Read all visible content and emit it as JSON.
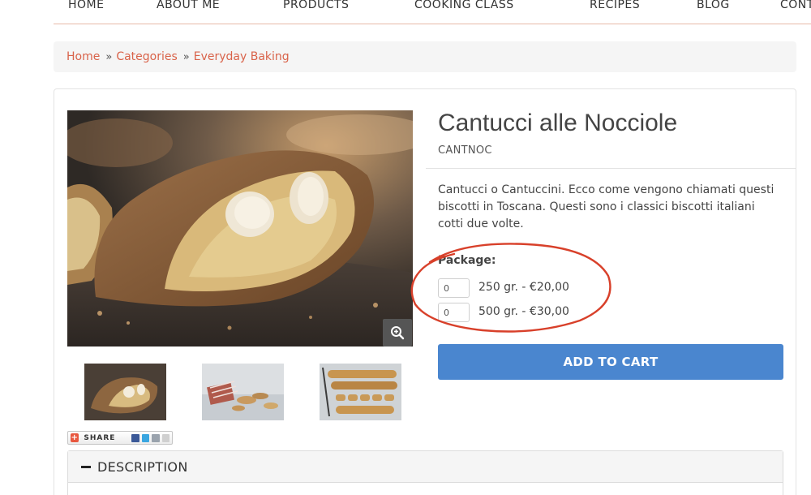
{
  "nav": {
    "items": [
      "HOME",
      "ABOUT ME",
      "PRODUCTS",
      "COOKING CLASS",
      "RECIPES",
      "BLOG",
      "CONT"
    ]
  },
  "breadcrumb": {
    "items": [
      "Home",
      "Categories",
      "Everyday Baking"
    ],
    "separator": "»"
  },
  "product": {
    "title": "Cantucci alle Nocciole",
    "sku": "CANTNOC",
    "description": "Cantucci o Cantuccini. Ecco come vengono chiamati questi biscotti in Toscana. Questi sono i classici biscotti italiani cotti due volte.",
    "package_label": "Package:",
    "options": [
      {
        "qty": "0",
        "label": "250 gr. - €20,00"
      },
      {
        "qty": "0",
        "label": "500 gr. - €30,00"
      }
    ],
    "add_to_cart": "ADD TO CART"
  },
  "share": {
    "label": "SHARE"
  },
  "tabs": {
    "description": "DESCRIPTION"
  },
  "colors": {
    "accent_link": "#d9634a",
    "cart_button": "#4a86cf",
    "annotation_circle": "#d8402a"
  },
  "icons": [
    "zoom-in-icon",
    "share-plus-icon",
    "facebook-icon",
    "twitter-icon",
    "email-icon",
    "more-icon",
    "minus-icon"
  ]
}
